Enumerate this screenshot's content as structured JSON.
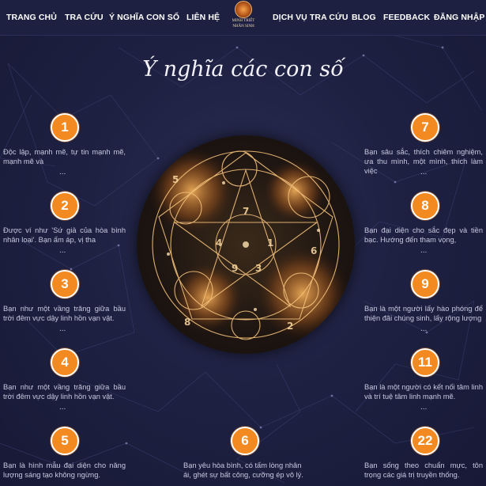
{
  "nav": {
    "left": [
      "TRANG CHỦ",
      "TRA CỨU",
      "Ý NGHĨA CON SỐ",
      "LIÊN HỆ"
    ],
    "right": [
      "DỊCH VỤ TRA CỨU",
      "BLOG",
      "FEEDBACK",
      "ĐĂNG NHẬP"
    ],
    "logo_line1": "MINH TRIẾT",
    "logo_line2": "NHÂN SINH"
  },
  "page_title": "Ý nghĩa các con số",
  "numbers_left": [
    {
      "number": "1",
      "text": "Độc lập, mạnh mẽ, tự tin mạnh mẽ, mạnh mẽ và",
      "more": "..."
    },
    {
      "number": "2",
      "text": "Được ví như 'Sứ giả của hòa bình nhân loại'. Bạn ấm áp, vị tha",
      "more": "..."
    },
    {
      "number": "3",
      "text": "Bạn như một vầng trăng giữa bầu trời đêm vực dậy linh hồn vạn vật.",
      "more": "..."
    },
    {
      "number": "4",
      "text": "Bạn như một vầng trăng giữa bầu trời đêm vực dậy linh hồn vạn vật.",
      "more": "..."
    },
    {
      "number": "5",
      "text": "Bạn là hình mẫu đại diện cho năng lượng sáng tạo không ngừng.",
      "more": ""
    }
  ],
  "numbers_right": [
    {
      "number": "7",
      "text": "Bạn sâu sắc, thích chiêm nghiệm, ưa thu mình, một mình, thích làm việc",
      "more": "..."
    },
    {
      "number": "8",
      "text": "Bạn đại diện cho sắc đẹp và tiền bạc. Hướng đến tham vọng,",
      "more": "..."
    },
    {
      "number": "9",
      "text": "Bạn là một người lấy hào phóng để thiện đãi chúng sinh, lấy rộng lượng",
      "more": "..."
    },
    {
      "number": "11",
      "text": "Bạn là một người có kết nối tâm linh và trí tuệ tâm linh mạnh mẽ.",
      "more": "..."
    },
    {
      "number": "22",
      "text": "Bạn sống theo chuẩn mực, tôn trọng các giá trị truyền thống.",
      "more": ""
    }
  ],
  "number_center": {
    "number": "6",
    "text": "Bạn yêu hòa bình, có tấm lòng nhân ái, ghét sự bất công, cưỡng ép vô lý."
  },
  "colors": {
    "badge": "#f28a21",
    "background": "#1e2142",
    "nav": "#1d2040"
  }
}
